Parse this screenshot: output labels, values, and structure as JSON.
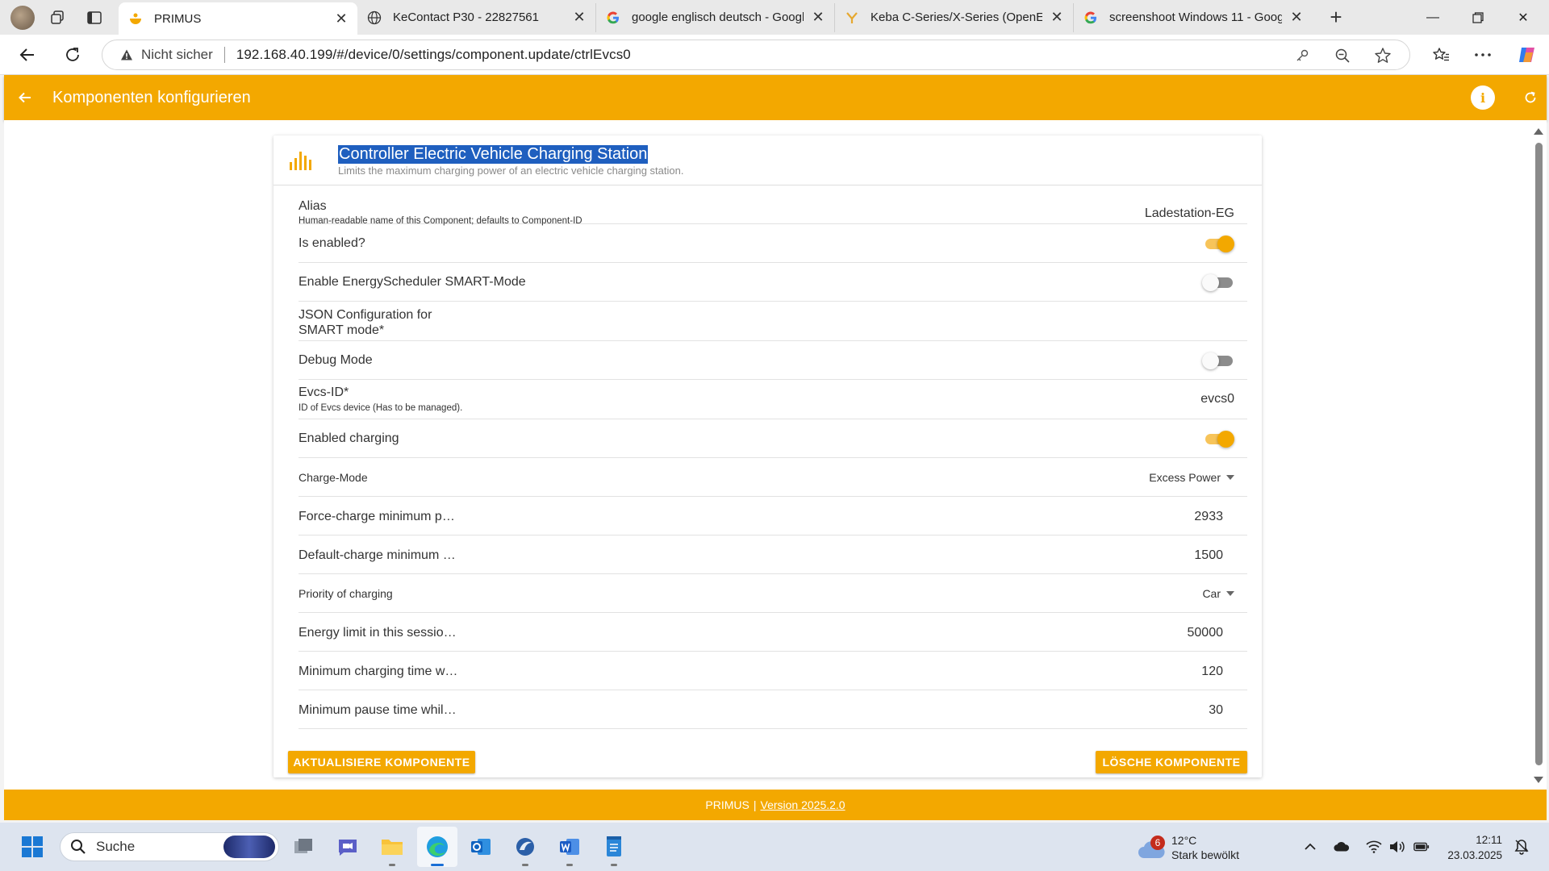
{
  "browser": {
    "tabs": [
      {
        "title": "PRIMUS",
        "active": true
      },
      {
        "title": "KeContact P30 - 22827561"
      },
      {
        "title": "google englisch deutsch - Google"
      },
      {
        "title": "Keba C-Series/X-Series (OpenEMS"
      },
      {
        "title": "screenshoot Windows 11 - Google"
      }
    ],
    "security_label": "Nicht sicher",
    "url": "192.168.40.199/#/device/0/settings/component.update/ctrlEvcs0"
  },
  "header": {
    "title": "Komponenten konfigurieren",
    "info_label": "i"
  },
  "component": {
    "title": "Controller Electric Vehicle Charging Station",
    "subtitle": "Limits the maximum charging power of an electric vehicle charging station.",
    "rows": [
      {
        "label": "Alias",
        "hint": "Human-readable name of this Component; defaults to Component-ID",
        "value": "Ladestation-EG"
      },
      {
        "label": "Is enabled?",
        "toggle": true
      },
      {
        "label": "Enable EnergyScheduler SMART-Mode",
        "toggle": false
      },
      {
        "label_line1": "JSON Configuration for",
        "label_line2": "SMART mode*"
      },
      {
        "label": "Debug Mode",
        "toggle": false
      },
      {
        "label": "Evcs-ID*",
        "hint": "ID of Evcs device (Has to be managed).",
        "value": "evcs0"
      },
      {
        "label": "Enabled charging",
        "toggle": true
      },
      {
        "label": "Charge-Mode",
        "value": "Excess Power"
      },
      {
        "label": "Force-charge minimum p…",
        "value": "2933"
      },
      {
        "label": "Default-charge minimum …",
        "value": "1500"
      },
      {
        "label": "Priority of charging",
        "value": "Car"
      },
      {
        "label": "Energy limit in this sessio…",
        "value": "50000"
      },
      {
        "label": "Minimum charging time w…",
        "value": "120"
      },
      {
        "label": "Minimum pause time whil…",
        "value": "30"
      }
    ],
    "update_button": "AKTUALISIERE KOMPONENTE",
    "delete_button": "LÖSCHE KOMPONENTE"
  },
  "footer": {
    "brand": "PRIMUS",
    "separator": "|",
    "version": "Version 2025.2.0"
  },
  "taskbar": {
    "search_label": "Suche",
    "weather_badge": "6",
    "weather_temp": "12°C",
    "weather_condition": "Stark bewölkt",
    "time": "12:11",
    "date": "23.03.2025"
  },
  "colors": {
    "accent": "#f3a800",
    "selection": "#1f5fbf"
  }
}
